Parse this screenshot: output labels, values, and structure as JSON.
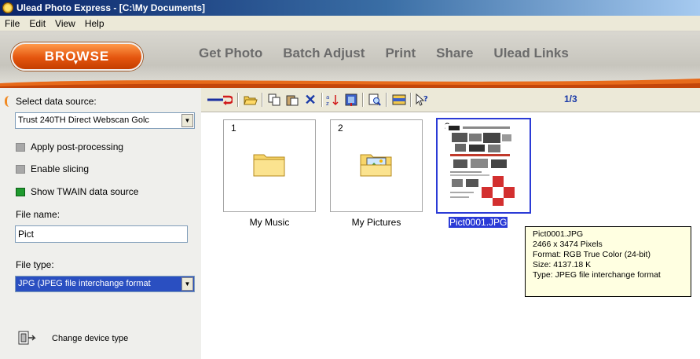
{
  "window": {
    "title": "Ulead Photo Express - [C:\\My Documents]"
  },
  "menu": {
    "items": [
      "File",
      "Edit",
      "View",
      "Help"
    ]
  },
  "banner": {
    "browse_label": "BROWSE",
    "tabs": [
      "Get Photo",
      "Batch Adjust",
      "Print",
      "Share",
      "Ulead Links"
    ]
  },
  "sidebar": {
    "data_source_label": "Select data source:",
    "data_source_value": "Trust 240TH Direct Webscan Golc",
    "options": [
      {
        "label": "Apply post-processing",
        "checked": false
      },
      {
        "label": "Enable slicing",
        "checked": false
      },
      {
        "label": "Show TWAIN data source",
        "checked": true
      }
    ],
    "file_name_label": "File name:",
    "file_name_value": "Pict",
    "file_type_label": "File type:",
    "file_type_value": "JPG (JPEG file interchange format",
    "change_device_label": "Change device type"
  },
  "toolbar": {
    "page_indicator": "1/3"
  },
  "files": [
    {
      "index": "1",
      "name": "My Music",
      "kind": "folder"
    },
    {
      "index": "2",
      "name": "My Pictures",
      "kind": "folder-pictures"
    },
    {
      "index": "3",
      "name": "Pict0001.JPG",
      "kind": "image",
      "selected": true
    }
  ],
  "tooltip": {
    "lines": [
      "Pict0001.JPG",
      "2466 x 3474 Pixels",
      "Format: RGB True Color (24-bit)",
      "Size: 4137.18 K",
      "Type: JPEG file interchange format"
    ]
  },
  "colors": {
    "accent_orange": "#e4550e",
    "selection_blue": "#2b3bd6",
    "title_blue": "#0a246a"
  }
}
